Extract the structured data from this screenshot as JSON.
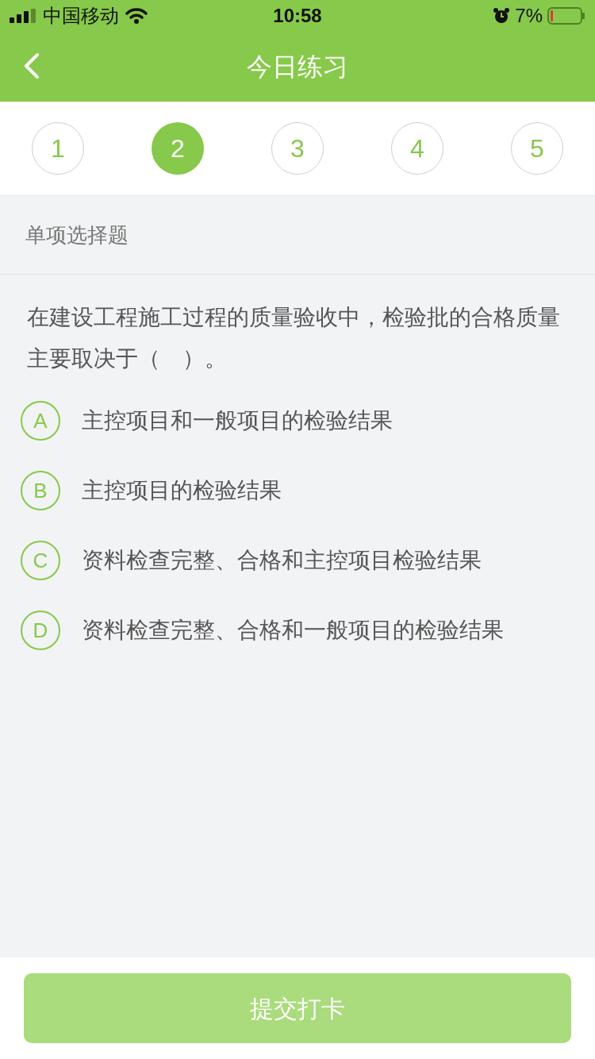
{
  "status_bar": {
    "carrier": "中国移动",
    "time": "10:58",
    "battery": "7%"
  },
  "nav": {
    "title": "今日练习"
  },
  "steps": [
    {
      "label": "1",
      "selected": false
    },
    {
      "label": "2",
      "selected": true
    },
    {
      "label": "3",
      "selected": false
    },
    {
      "label": "4",
      "selected": false
    },
    {
      "label": "5",
      "selected": false
    }
  ],
  "question_type": "单项选择题",
  "question": "在建设工程施工过程的质量验收中，检验批的合格质量主要取决于（　）。",
  "options": [
    {
      "letter": "A",
      "text": "主控项目和一般项目的检验结果",
      "selected": false
    },
    {
      "letter": "B",
      "text": "主控项目的检验结果",
      "selected": false
    },
    {
      "letter": "C",
      "text": "资料检查完整、合格和主控项目检验结果",
      "selected": false
    },
    {
      "letter": "D",
      "text": "资料检查完整、合格和一般项目的检验结果",
      "selected": false
    }
  ],
  "submit_button": {
    "label": "提交打卡",
    "disabled": true
  }
}
